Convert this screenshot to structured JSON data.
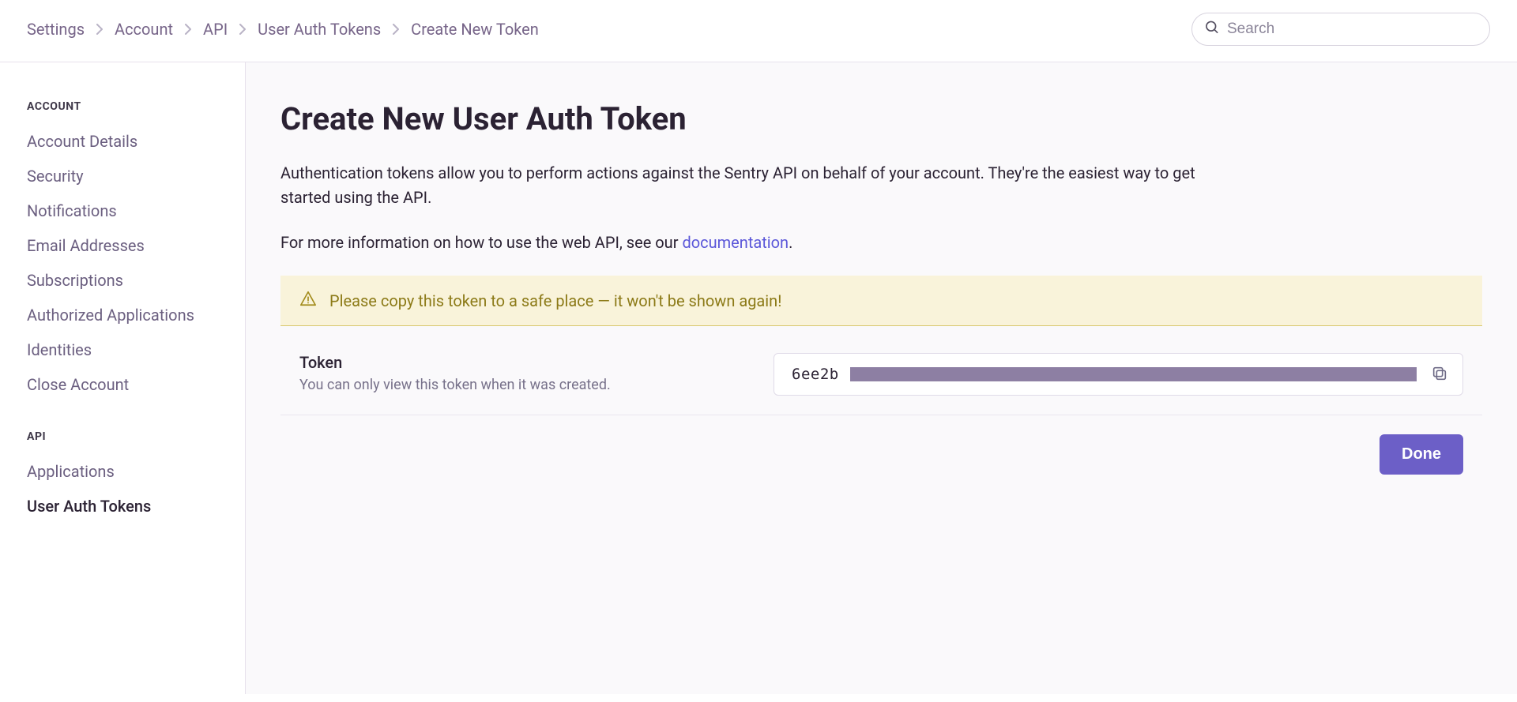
{
  "header": {
    "breadcrumbs": [
      "Settings",
      "Account",
      "API",
      "User Auth Tokens",
      "Create New Token"
    ],
    "search_placeholder": "Search"
  },
  "sidebar": {
    "sections": [
      {
        "title": "ACCOUNT",
        "items": [
          {
            "label": "Account Details",
            "active": false
          },
          {
            "label": "Security",
            "active": false
          },
          {
            "label": "Notifications",
            "active": false
          },
          {
            "label": "Email Addresses",
            "active": false
          },
          {
            "label": "Subscriptions",
            "active": false
          },
          {
            "label": "Authorized Applications",
            "active": false
          },
          {
            "label": "Identities",
            "active": false
          },
          {
            "label": "Close Account",
            "active": false
          }
        ]
      },
      {
        "title": "API",
        "items": [
          {
            "label": "Applications",
            "active": false
          },
          {
            "label": "User Auth Tokens",
            "active": true
          }
        ]
      }
    ]
  },
  "main": {
    "title": "Create New User Auth Token",
    "intro1": "Authentication tokens allow you to perform actions against the Sentry API on behalf of your account. They're the easiest way to get started using the API.",
    "intro2_prefix": "For more information on how to use the web API, see our ",
    "intro2_link": "documentation",
    "intro2_suffix": ".",
    "alert_text": "Please copy this token to a safe place — it won't be shown again!",
    "token_label": "Token",
    "token_help": "You can only view this token when it was created.",
    "token_prefix": "6ee2b",
    "done_label": "Done"
  }
}
